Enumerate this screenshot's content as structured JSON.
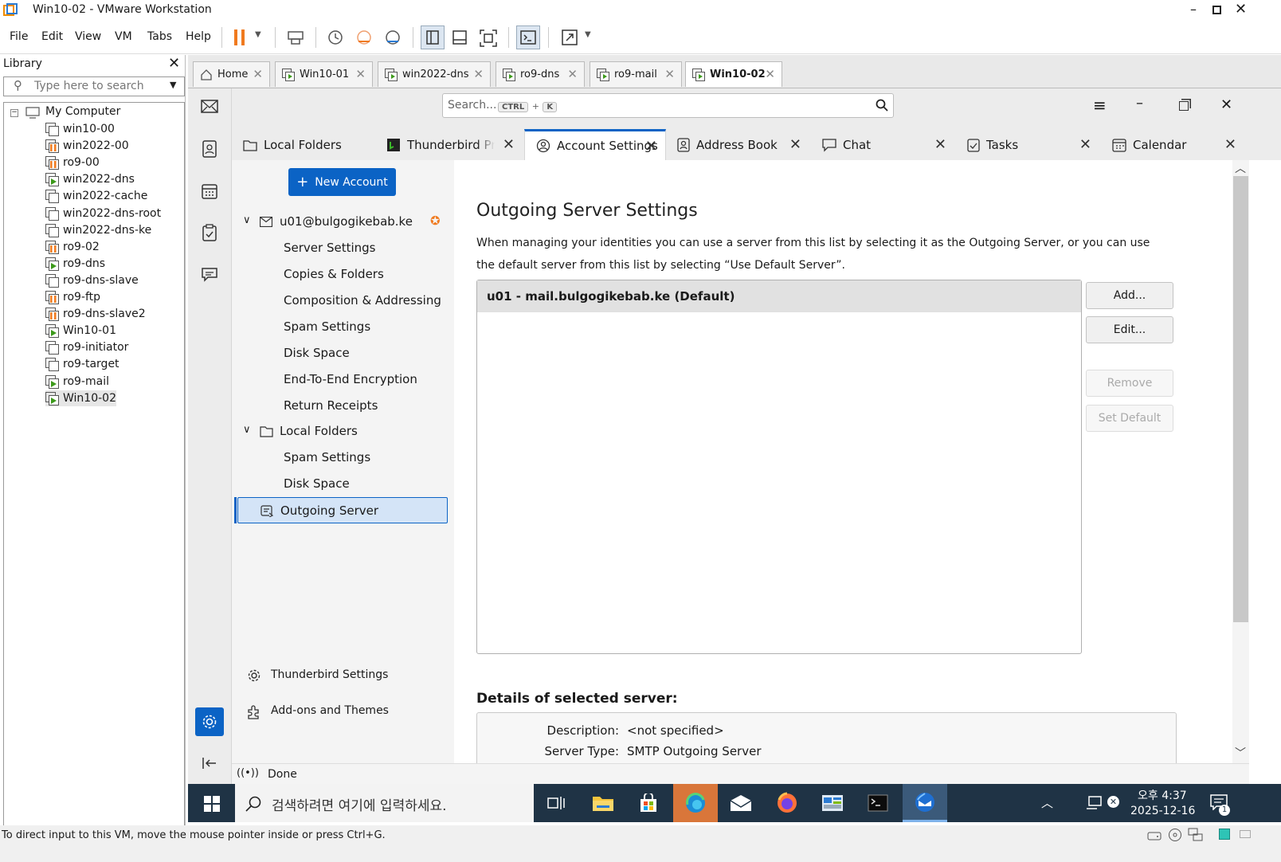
{
  "window": {
    "title": "Win10-02 - VMware Workstation"
  },
  "menu": [
    "File",
    "Edit",
    "View",
    "VM",
    "Tabs",
    "Help"
  ],
  "library": {
    "title": "Library",
    "search_placeholder": "Type here to search",
    "root": "My Computer",
    "vms": [
      {
        "name": "win10-00",
        "state": "off"
      },
      {
        "name": "win2022-00",
        "state": "paused"
      },
      {
        "name": "ro9-00",
        "state": "paused"
      },
      {
        "name": "win2022-dns",
        "state": "running"
      },
      {
        "name": "win2022-cache",
        "state": "off"
      },
      {
        "name": "win2022-dns-root",
        "state": "off"
      },
      {
        "name": "win2022-dns-ke",
        "state": "off"
      },
      {
        "name": "ro9-02",
        "state": "paused"
      },
      {
        "name": "ro9-dns",
        "state": "running"
      },
      {
        "name": "ro9-dns-slave",
        "state": "off"
      },
      {
        "name": "ro9-ftp",
        "state": "paused"
      },
      {
        "name": "ro9-dns-slave2",
        "state": "paused"
      },
      {
        "name": "Win10-01",
        "state": "running"
      },
      {
        "name": "ro9-initiator",
        "state": "off"
      },
      {
        "name": "ro9-target",
        "state": "off"
      },
      {
        "name": "ro9-mail",
        "state": "running"
      },
      {
        "name": "Win10-02",
        "state": "running"
      }
    ]
  },
  "vm_tabs": [
    "Home",
    "Win10-01",
    "win2022-dns",
    "ro9-dns",
    "ro9-mail",
    "Win10-02"
  ],
  "thunderbird": {
    "search": {
      "placeholder": "Search...",
      "key1": "CTRL",
      "plus": "+",
      "key2": "K"
    },
    "tabs": [
      "Local Folders",
      "Thunderbird Priv",
      "Account Settings",
      "Address Book",
      "Chat",
      "Tasks",
      "Calendar"
    ],
    "new_account": "New Account",
    "account": "u01@bulgogikebab.ke",
    "account_items": [
      "Server Settings",
      "Copies & Folders",
      "Composition & Addressing",
      "Spam Settings",
      "Disk Space",
      "End-To-End Encryption",
      "Return Receipts"
    ],
    "local_folders": "Local Folders",
    "local_items": [
      "Spam Settings",
      "Disk Space"
    ],
    "outgoing": "Outgoing Server",
    "settings_link": "Thunderbird Settings",
    "addons_link": "Add-ons and Themes",
    "page_title": "Outgoing Server Settings",
    "description_line1": "When managing your identities you can use a server from this list by selecting it as the Outgoing Server, or you can use",
    "description_line2": "the default server from this list by selecting “Use Default Server”.",
    "server_entry": "u01 - mail.bulgogikebab.ke (Default)",
    "buttons": {
      "add": "Add...",
      "edit": "Edit...",
      "remove": "Remove",
      "set_default": "Set Default"
    },
    "details_title": "Details of selected server:",
    "details": [
      {
        "label": "Description:",
        "value": "<not specified>"
      },
      {
        "label": "Server Type:",
        "value": "SMTP Outgoing Server"
      }
    ],
    "status": "Done"
  },
  "taskbar": {
    "search_placeholder": "검색하려면 여기에 입력하세요.",
    "time": "오후 4:37",
    "date": "2025-12-16",
    "notification_count": "1"
  },
  "vm_status": "To direct input to this VM, move the mouse pointer inside or press Ctrl+G.",
  "colors": {
    "accent": "#0b63c5",
    "vm_pause": "#f07a1e",
    "vm_run": "#3d9a1b",
    "taskbar": "#1f3345"
  }
}
